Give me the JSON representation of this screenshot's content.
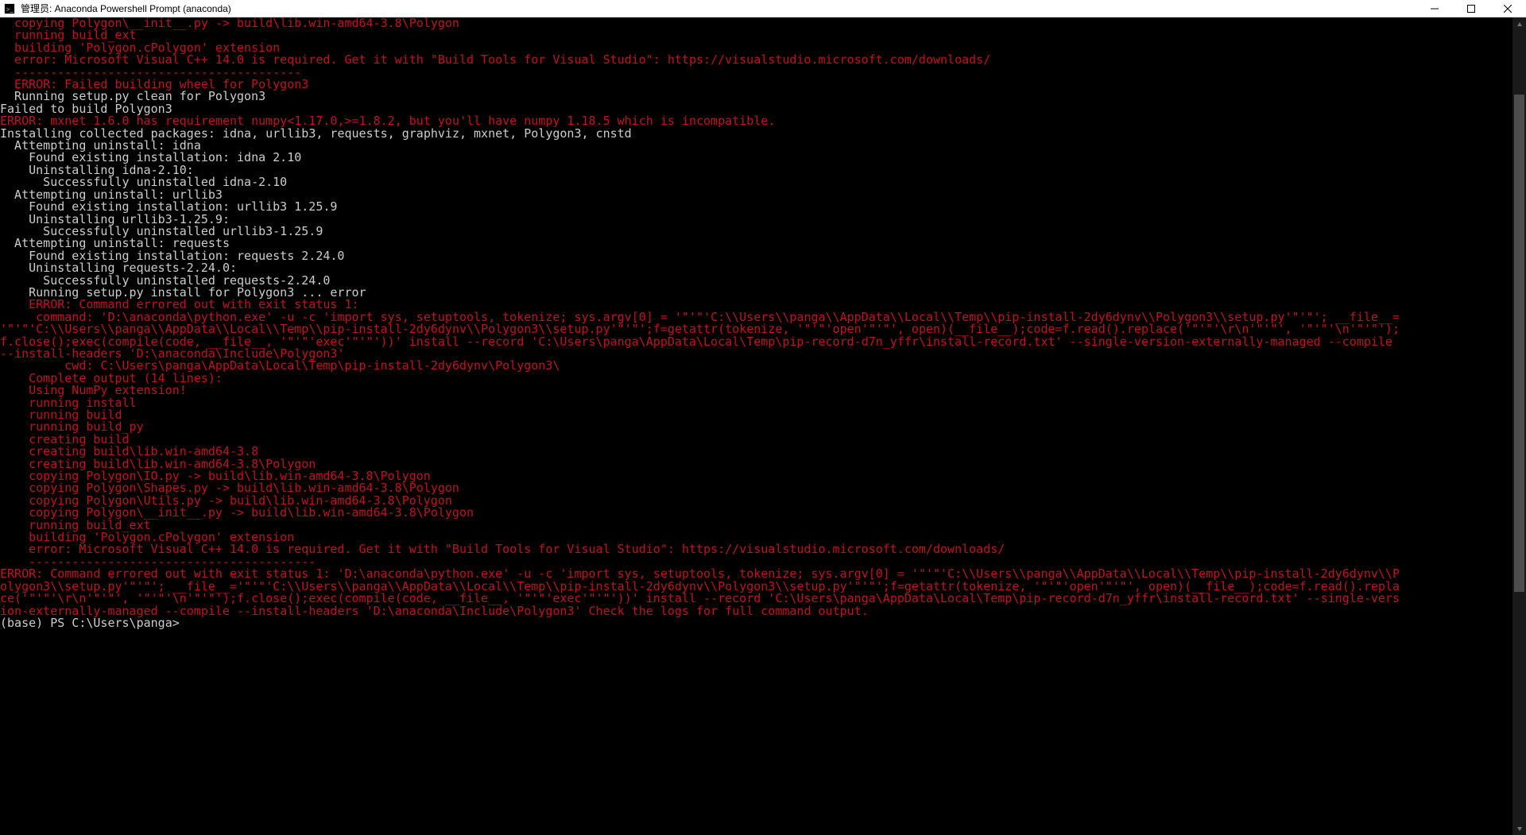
{
  "window": {
    "title": "管理员: Anaconda Powershell Prompt (anaconda)"
  },
  "scrollbar": {
    "thumb_top_pct": 8,
    "thumb_height_pct": 63
  },
  "prompt": "(base) PS C:\\Users\\panga>",
  "lines": [
    {
      "cls": "red i2",
      "t": "copying Polygon\\__init__.py -> build\\lib.win-amd64-3.8\\Polygon"
    },
    {
      "cls": "red i2",
      "t": "running build_ext"
    },
    {
      "cls": "red i2",
      "t": "building 'Polygon.cPolygon' extension"
    },
    {
      "cls": "red i2",
      "t": "error: Microsoft Visual C++ 14.0 is required. Get it with \"Build Tools for Visual Studio\": https://visualstudio.microsoft.com/downloads/"
    },
    {
      "cls": "red i2",
      "t": "----------------------------------------"
    },
    {
      "cls": "red i2",
      "t": "ERROR: Failed building wheel for Polygon3"
    },
    {
      "cls": "white i2",
      "t": "Running setup.py clean for Polygon3"
    },
    {
      "cls": "white i0",
      "t": "Failed to build Polygon3"
    },
    {
      "cls": "red i0",
      "t": "ERROR: mxnet 1.6.0 has requirement numpy<1.17.0,>=1.8.2, but you'll have numpy 1.18.5 which is incompatible."
    },
    {
      "cls": "white i0",
      "t": "Installing collected packages: idna, urllib3, requests, graphviz, mxnet, Polygon3, cnstd"
    },
    {
      "cls": "white i2",
      "t": "Attempting uninstall: idna"
    },
    {
      "cls": "white i4",
      "t": "Found existing installation: idna 2.10"
    },
    {
      "cls": "white i4",
      "t": "Uninstalling idna-2.10:"
    },
    {
      "cls": "white i6",
      "t": "Successfully uninstalled idna-2.10"
    },
    {
      "cls": "white i2",
      "t": "Attempting uninstall: urllib3"
    },
    {
      "cls": "white i4",
      "t": "Found existing installation: urllib3 1.25.9"
    },
    {
      "cls": "white i4",
      "t": "Uninstalling urllib3-1.25.9:"
    },
    {
      "cls": "white i6",
      "t": "Successfully uninstalled urllib3-1.25.9"
    },
    {
      "cls": "white i2",
      "t": "Attempting uninstall: requests"
    },
    {
      "cls": "white i4",
      "t": "Found existing installation: requests 2.24.0"
    },
    {
      "cls": "white i4",
      "t": "Uninstalling requests-2.24.0:"
    },
    {
      "cls": "white i6",
      "t": "Successfully uninstalled requests-2.24.0"
    },
    {
      "cls": "white i4",
      "t": "Running setup.py install for Polygon3 ... error"
    },
    {
      "cls": "red i4",
      "t": "ERROR: Command errored out with exit status 1:"
    },
    {
      "cls": "red i0",
      "t": "     command: 'D:\\anaconda\\python.exe' -u -c 'import sys, setuptools, tokenize; sys.argv[0] = '\"'\"'C:\\\\Users\\\\panga\\\\AppData\\\\Local\\\\Temp\\\\pip-install-2dy6dynv\\\\Polygon3\\\\setup.py'\"'\"'; __file__='\"'\"'C:\\\\Users\\\\panga\\\\AppData\\\\Local\\\\Temp\\\\pip-install-2dy6dynv\\\\Polygon3\\\\setup.py'\"'\"';f=getattr(tokenize, '\"'\"'open'\"'\"', open)(__file__);code=f.read().replace('\"'\"'\\r\\n'\"'\"', '\"'\"'\\n'\"'\"');f.close();exec(compile(code, __file__, '\"'\"'exec'\"'\"'))' install --record 'C:\\Users\\panga\\AppData\\Local\\Temp\\pip-record-d7n_yffr\\install-record.txt' --single-version-externally-managed --compile --install-headers 'D:\\anaconda\\Include\\Polygon3'"
    },
    {
      "cls": "red i0",
      "t": "         cwd: C:\\Users\\panga\\AppData\\Local\\Temp\\pip-install-2dy6dynv\\Polygon3\\"
    },
    {
      "cls": "red i4",
      "t": "Complete output (14 lines):"
    },
    {
      "cls": "red i4",
      "t": "Using NumPy extension!"
    },
    {
      "cls": "red i4",
      "t": "running install"
    },
    {
      "cls": "red i4",
      "t": "running build"
    },
    {
      "cls": "red i4",
      "t": "running build_py"
    },
    {
      "cls": "red i4",
      "t": "creating build"
    },
    {
      "cls": "red i4",
      "t": "creating build\\lib.win-amd64-3.8"
    },
    {
      "cls": "red i4",
      "t": "creating build\\lib.win-amd64-3.8\\Polygon"
    },
    {
      "cls": "red i4",
      "t": "copying Polygon\\IO.py -> build\\lib.win-amd64-3.8\\Polygon"
    },
    {
      "cls": "red i4",
      "t": "copying Polygon\\Shapes.py -> build\\lib.win-amd64-3.8\\Polygon"
    },
    {
      "cls": "red i4",
      "t": "copying Polygon\\Utils.py -> build\\lib.win-amd64-3.8\\Polygon"
    },
    {
      "cls": "red i4",
      "t": "copying Polygon\\__init__.py -> build\\lib.win-amd64-3.8\\Polygon"
    },
    {
      "cls": "red i4",
      "t": "running build_ext"
    },
    {
      "cls": "red i4",
      "t": "building 'Polygon.cPolygon' extension"
    },
    {
      "cls": "red i4",
      "t": "error: Microsoft Visual C++ 14.0 is required. Get it with \"Build Tools for Visual Studio\": https://visualstudio.microsoft.com/downloads/"
    },
    {
      "cls": "red i4",
      "t": "----------------------------------------"
    },
    {
      "cls": "red i0",
      "t": "ERROR: Command errored out with exit status 1: 'D:\\anaconda\\python.exe' -u -c 'import sys, setuptools, tokenize; sys.argv[0] = '\"'\"'C:\\\\Users\\\\panga\\\\AppData\\\\Local\\\\Temp\\\\pip-install-2dy6dynv\\\\Polygon3\\\\setup.py'\"'\"'; __file__='\"'\"'C:\\\\Users\\\\panga\\\\AppData\\\\Local\\\\Temp\\\\pip-install-2dy6dynv\\\\Polygon3\\\\setup.py'\"'\"';f=getattr(tokenize, '\"'\"'open'\"'\"', open)(__file__);code=f.read().replace('\"'\"'\\r\\n'\"'\"', '\"'\"'\\n'\"'\"');f.close();exec(compile(code, __file__, '\"'\"'exec'\"'\"'))' install --record 'C:\\Users\\panga\\AppData\\Local\\Temp\\pip-record-d7n_yffr\\install-record.txt' --single-version-externally-managed --compile --install-headers 'D:\\anaconda\\Include\\Polygon3' Check the logs for full command output."
    }
  ]
}
